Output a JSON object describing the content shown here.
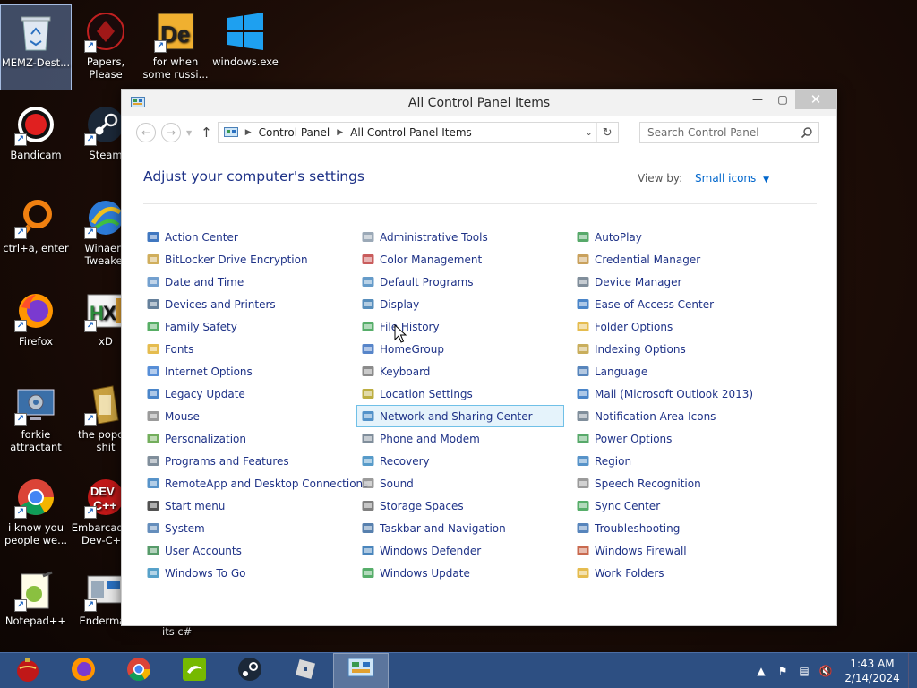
{
  "desktop": {
    "icons": [
      {
        "label": "MEMZ-Dest...",
        "icon": "recycle-bin-icon"
      },
      {
        "label": "Papers, Please",
        "icon": "papers-please-icon"
      },
      {
        "label": "for when some russi...",
        "icon": "de-icon"
      },
      {
        "label": "windows.exe",
        "icon": "windows-logo-icon"
      },
      {
        "label": "Bandicam",
        "icon": "bandicam-icon"
      },
      {
        "label": "Steam",
        "icon": "steam-icon"
      },
      {
        "label": "ctrl+a, enter",
        "icon": "ring-icon"
      },
      {
        "label": "Winaero Tweaker",
        "icon": "winaero-icon"
      },
      {
        "label": "Firefox",
        "icon": "firefox-icon"
      },
      {
        "label": "xD",
        "icon": "hxd-icon"
      },
      {
        "label": "forkie attractant",
        "icon": "gear-monitor-icon"
      },
      {
        "label": "the popcat shit",
        "icon": "folder-icon"
      },
      {
        "label": "i know you people we...",
        "icon": "chrome-icon"
      },
      {
        "label": "Embarcadero Dev-C++",
        "icon": "devcpp-icon"
      },
      {
        "label": "Notepad++",
        "icon": "notepadpp-icon"
      },
      {
        "label": "Enderman",
        "icon": "enderman-icon"
      }
    ],
    "stray_label": "its c#"
  },
  "window": {
    "title": "All Control Panel Items",
    "address": {
      "crumbs": [
        "Control Panel",
        "All Control Panel Items"
      ]
    },
    "search_placeholder": "Search Control Panel",
    "heading": "Adjust your computer's settings",
    "view_by_label": "View by:",
    "view_by_value": "Small icons",
    "columns": [
      [
        {
          "label": "Action Center",
          "color": "#1e5fb5"
        },
        {
          "label": "BitLocker Drive Encryption",
          "color": "#c8a040"
        },
        {
          "label": "Date and Time",
          "color": "#5b8fc7"
        },
        {
          "label": "Devices and Printers",
          "color": "#4a6a8a"
        },
        {
          "label": "Family Safety",
          "color": "#3aa04a"
        },
        {
          "label": "Fonts",
          "color": "#e0b030"
        },
        {
          "label": "Internet Options",
          "color": "#3a7ad0"
        },
        {
          "label": "Legacy Update",
          "color": "#2a70c0"
        },
        {
          "label": "Mouse",
          "color": "#888888"
        },
        {
          "label": "Personalization",
          "color": "#5aa040"
        },
        {
          "label": "Programs and Features",
          "color": "#6a7a8a"
        },
        {
          "label": "RemoteApp and Desktop Connections",
          "color": "#3a80c0"
        },
        {
          "label": "Start menu",
          "color": "#333333"
        },
        {
          "label": "System",
          "color": "#4a7ab0"
        },
        {
          "label": "User Accounts",
          "color": "#3a8a50"
        },
        {
          "label": "Windows To Go",
          "color": "#3a90c0"
        }
      ],
      [
        {
          "label": "Administrative Tools",
          "color": "#8a9aaa"
        },
        {
          "label": "Color Management",
          "color": "#c04040"
        },
        {
          "label": "Default Programs",
          "color": "#4a8ac0"
        },
        {
          "label": "Display",
          "color": "#3a7ab0"
        },
        {
          "label": "File History",
          "color": "#3aa050"
        },
        {
          "label": "HomeGroup",
          "color": "#3a70c0"
        },
        {
          "label": "Keyboard",
          "color": "#777777"
        },
        {
          "label": "Location Settings",
          "color": "#b0a020"
        },
        {
          "label": "Network and Sharing Center",
          "color": "#3a80c0"
        },
        {
          "label": "Phone and Modem",
          "color": "#6a7a8a"
        },
        {
          "label": "Recovery",
          "color": "#3a8ac0"
        },
        {
          "label": "Sound",
          "color": "#8a8a8a"
        },
        {
          "label": "Storage Spaces",
          "color": "#6a6a6a"
        },
        {
          "label": "Taskbar and Navigation",
          "color": "#3a6aa0"
        },
        {
          "label": "Windows Defender",
          "color": "#2a70b0"
        },
        {
          "label": "Windows Update",
          "color": "#3aa050"
        }
      ],
      [
        {
          "label": "AutoPlay",
          "color": "#3a9a50"
        },
        {
          "label": "Credential Manager",
          "color": "#c09040"
        },
        {
          "label": "Device Manager",
          "color": "#6a7a8a"
        },
        {
          "label": "Ease of Access Center",
          "color": "#2a70c0"
        },
        {
          "label": "Folder Options",
          "color": "#e0b030"
        },
        {
          "label": "Indexing Options",
          "color": "#c0a040"
        },
        {
          "label": "Language",
          "color": "#3a70b0"
        },
        {
          "label": "Mail (Microsoft Outlook 2013)",
          "color": "#2a70c0"
        },
        {
          "label": "Notification Area Icons",
          "color": "#6a7a8a"
        },
        {
          "label": "Power Options",
          "color": "#3a9a50"
        },
        {
          "label": "Region",
          "color": "#3a80c0"
        },
        {
          "label": "Speech Recognition",
          "color": "#8a8a8a"
        },
        {
          "label": "Sync Center",
          "color": "#3aa050"
        },
        {
          "label": "Troubleshooting",
          "color": "#3a70b0"
        },
        {
          "label": "Windows Firewall",
          "color": "#c05030"
        },
        {
          "label": "Work Folders",
          "color": "#e0b030"
        }
      ]
    ],
    "hovered_item": "Network and Sharing Center"
  },
  "taskbar": {
    "items": [
      "christmas-ornament-icon",
      "firefox-icon",
      "chrome-icon",
      "nvidia-icon",
      "steam-icon",
      "roblox-icon",
      "control-panel-icon"
    ],
    "active_item": "control-panel-icon",
    "clock_time": "1:43 AM",
    "clock_date": "2/14/2024"
  }
}
